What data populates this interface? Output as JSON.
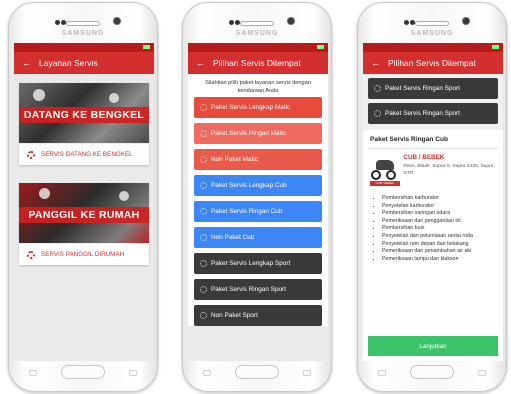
{
  "device": {
    "brand": "SAMSUNG"
  },
  "screen1": {
    "title": "Layanan Servis",
    "cards": [
      {
        "banner": "DATANG KE BENGKEL",
        "label": "SERVIS DATANG KE BENGKEL"
      },
      {
        "banner": "PANGGIL KE RUMAH",
        "label": "SERVIS PANGGIL DIRUMAH"
      }
    ]
  },
  "screen2": {
    "title": "Pilihan Servis Ditempat",
    "intro": "Silahkan pilih paket layanan servis dengan kendaraan Anda",
    "options": [
      {
        "label": "Paket Servis Lengkap Matic",
        "color": "#e64b3b"
      },
      {
        "label": "Paket Servis Ringan Matic",
        "color": "#ef6b5f"
      },
      {
        "label": "Non Paket Matic",
        "color": "#ea5a4a"
      },
      {
        "label": "Paket Servis Lengkap Cub",
        "color": "#3d86f5"
      },
      {
        "label": "Paket Servis Ringan Cub",
        "color": "#3d86f5"
      },
      {
        "label": "Non Paket Cub",
        "color": "#3d86f5"
      },
      {
        "label": "Paket Servis Lengkap Sport",
        "color": "#3a3a3a"
      },
      {
        "label": "Paket Servis Ringan Sport",
        "color": "#3a3a3a"
      },
      {
        "label": "Non Paket Sport",
        "color": "#3a3a3a"
      }
    ]
  },
  "screen3": {
    "title": "Pilihan Servis Ditempat",
    "options": [
      {
        "label": "Paket Servis Ringan Sport"
      },
      {
        "label": "Paket Servis Ringan Sport"
      }
    ],
    "detail_title": "Paket Servis Ringan Cub",
    "moto_type": "CUB / BEBEK",
    "moto_tag": "CUB / BEBEK",
    "moto_models": "Revo, Blade, Supra-X, Supra X125, Supra GTR",
    "items": [
      "Pembersihan karburator",
      "Penyetelan karburator",
      "Pembersihan saringan udara",
      "Pemeriksaan dan penggantian oli",
      "Pembersihan busi",
      "Penyetelan dan pelumasan rantai roda",
      "Penyetelan rem depan dan belakang",
      "Pemeriksaan dan penambahan air aki",
      "Pemeriksaan lampu dan klakson"
    ],
    "next_label": "Lanjutkan"
  }
}
